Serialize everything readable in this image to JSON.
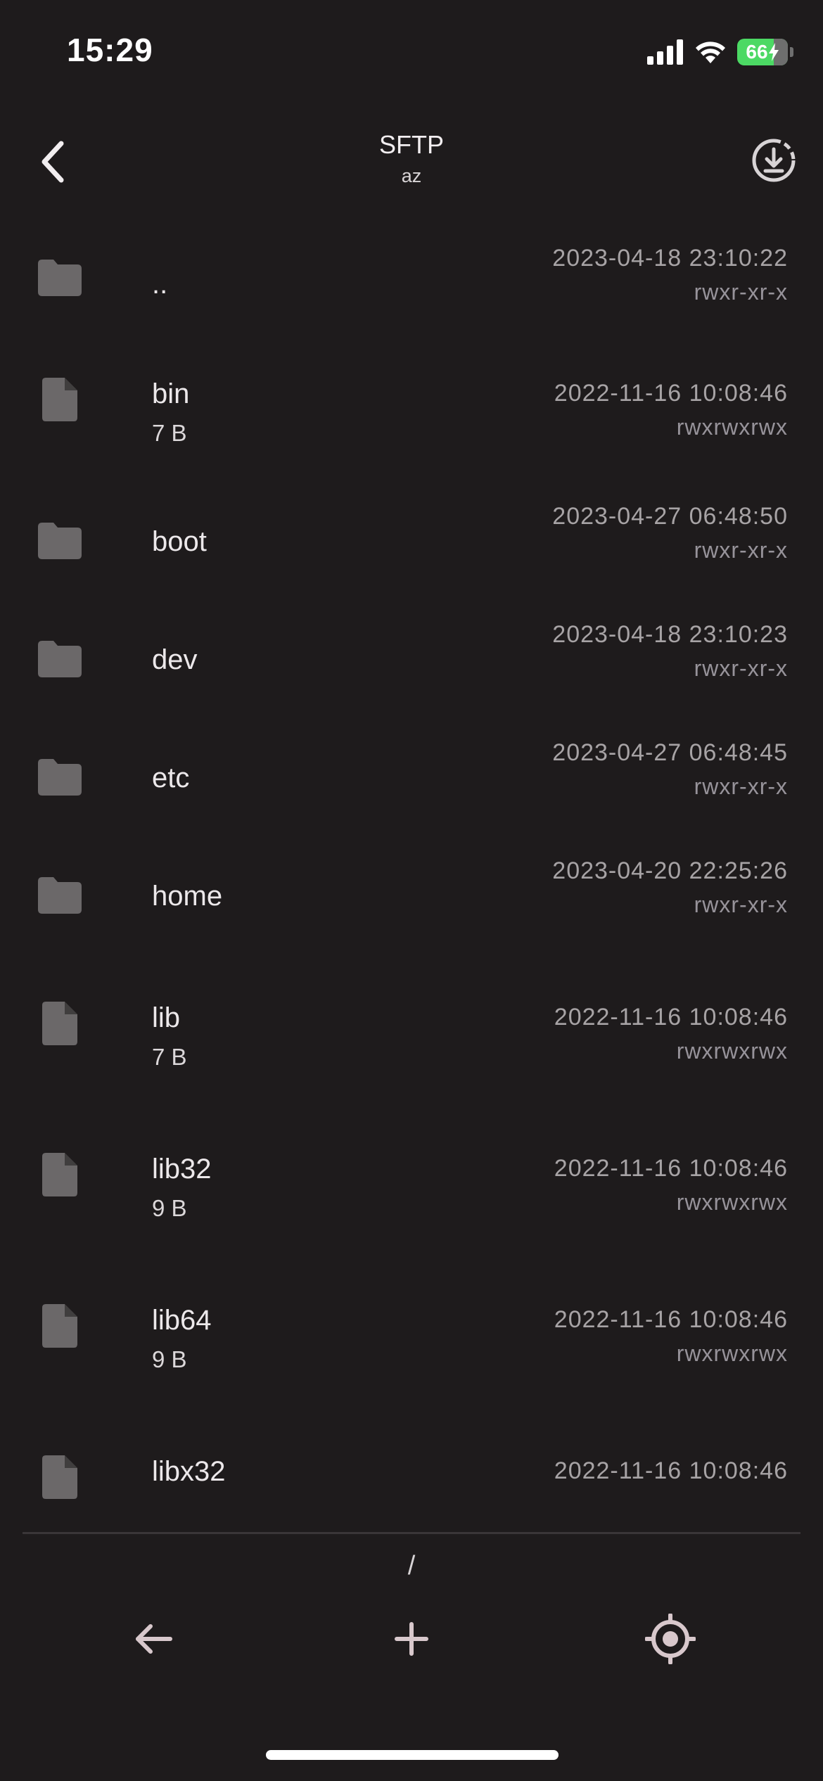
{
  "status_bar": {
    "time": "15:29",
    "battery_level": "66",
    "battery_charging": true
  },
  "header": {
    "title": "SFTP",
    "subtitle": "az"
  },
  "files": [
    {
      "name": "..",
      "type": "folder",
      "size": "",
      "date": "2023-04-18 23:10:22",
      "perm": "rwxr-xr-x"
    },
    {
      "name": "bin",
      "type": "file",
      "size": "7 B",
      "date": "2022-11-16 10:08:46",
      "perm": "rwxrwxrwx"
    },
    {
      "name": "boot",
      "type": "folder",
      "size": "",
      "date": "2023-04-27 06:48:50",
      "perm": "rwxr-xr-x"
    },
    {
      "name": "dev",
      "type": "folder",
      "size": "",
      "date": "2023-04-18 23:10:23",
      "perm": "rwxr-xr-x"
    },
    {
      "name": "etc",
      "type": "folder",
      "size": "",
      "date": "2023-04-27 06:48:45",
      "perm": "rwxr-xr-x"
    },
    {
      "name": "home",
      "type": "folder",
      "size": "",
      "date": "2023-04-20 22:25:26",
      "perm": "rwxr-xr-x"
    },
    {
      "name": "lib",
      "type": "file",
      "size": "7 B",
      "date": "2022-11-16 10:08:46",
      "perm": "rwxrwxrwx"
    },
    {
      "name": "lib32",
      "type": "file",
      "size": "9 B",
      "date": "2022-11-16 10:08:46",
      "perm": "rwxrwxrwx"
    },
    {
      "name": "lib64",
      "type": "file",
      "size": "9 B",
      "date": "2022-11-16 10:08:46",
      "perm": "rwxrwxrwx"
    },
    {
      "name": "libx32",
      "type": "file",
      "size": "",
      "date": "2022-11-16 10:08:46",
      "perm": ""
    }
  ],
  "footer": {
    "path": "/"
  },
  "icons": {
    "back": "chevron-left-icon",
    "download": "download-circle-icon",
    "folder": "folder-icon",
    "file": "file-icon",
    "toolbar_back": "arrow-left-icon",
    "toolbar_add": "plus-icon",
    "toolbar_locate": "crosshair-icon"
  },
  "colors": {
    "background": "#1e1b1c",
    "icon_gray": "#6b6869",
    "battery_green": "#4cd964"
  }
}
